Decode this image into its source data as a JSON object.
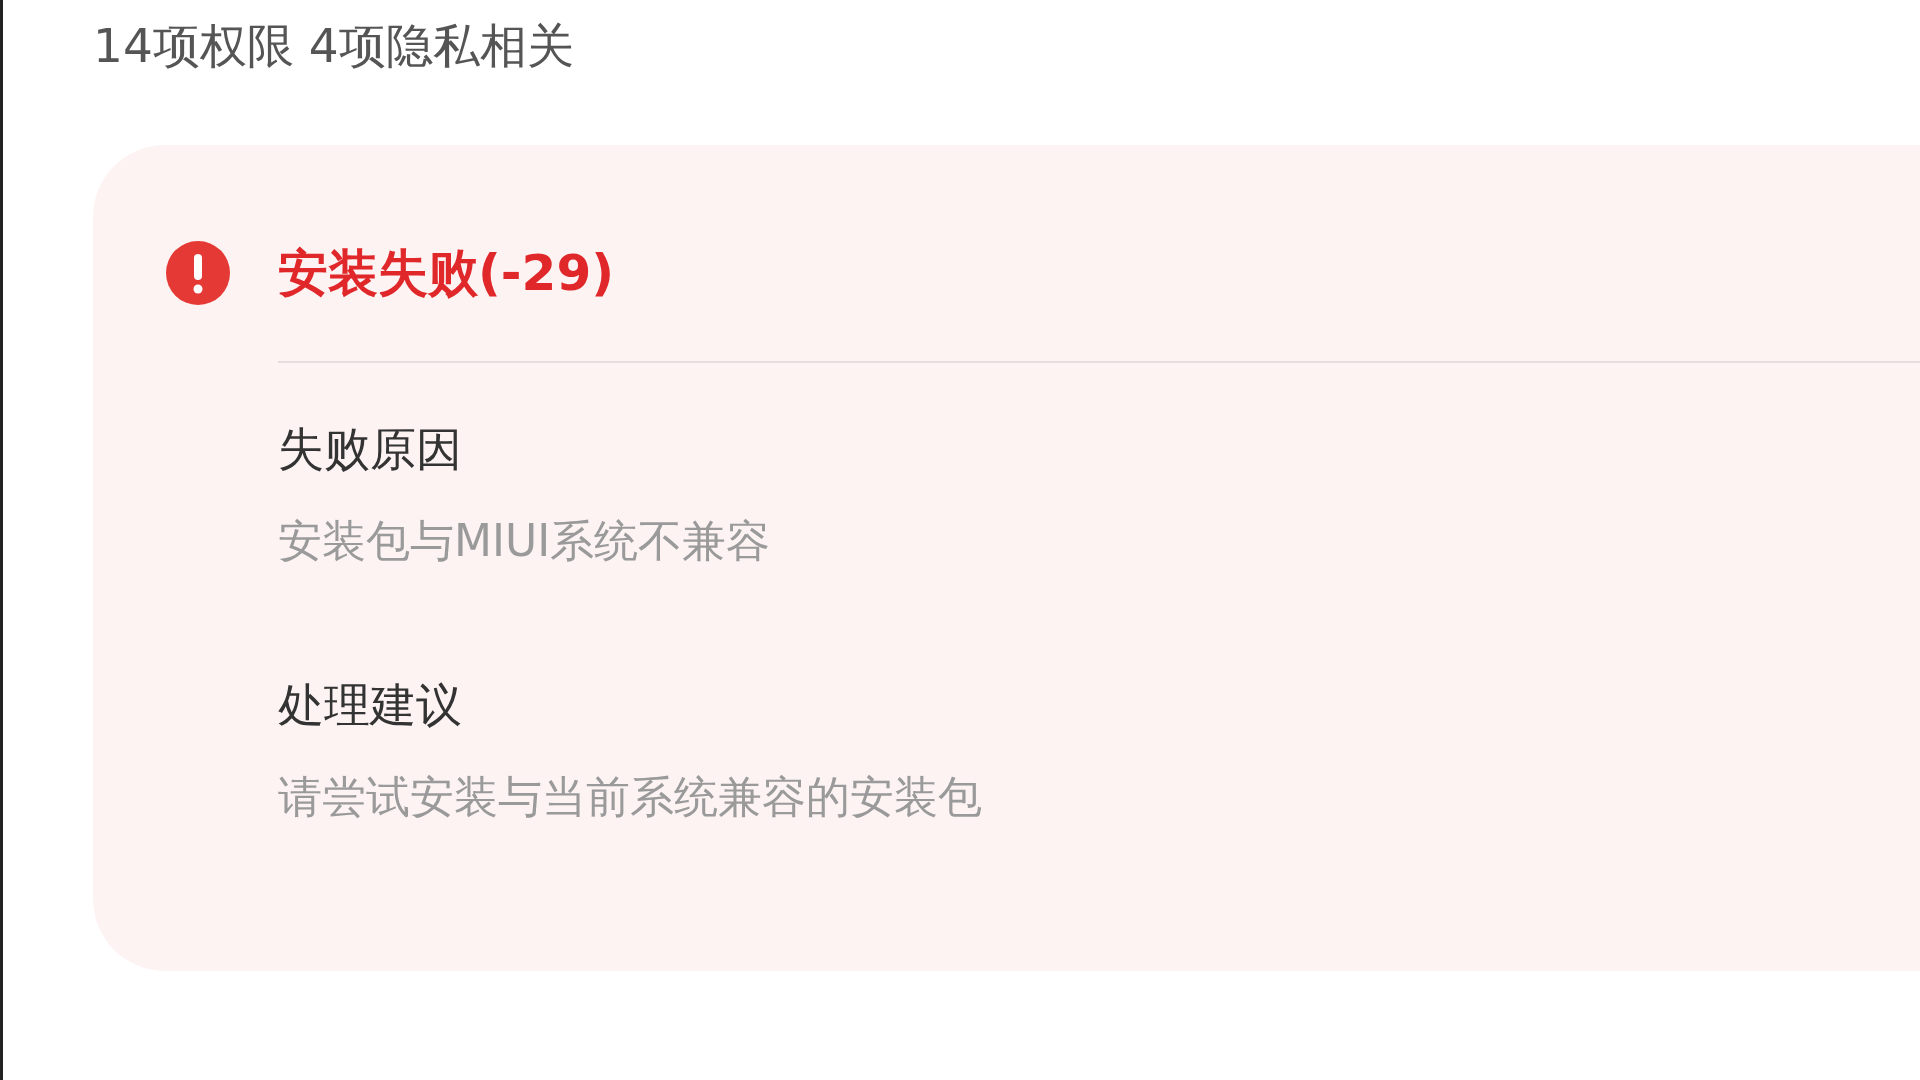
{
  "summary": "14项权限 4项隐私相关",
  "error": {
    "title": "安装失败(-29)",
    "sections": [
      {
        "heading": "失败原因",
        "text": "安装包与MIUI系统不兼容"
      },
      {
        "heading": "处理建议",
        "text": "请尝试安装与当前系统兼容的安装包"
      }
    ]
  }
}
